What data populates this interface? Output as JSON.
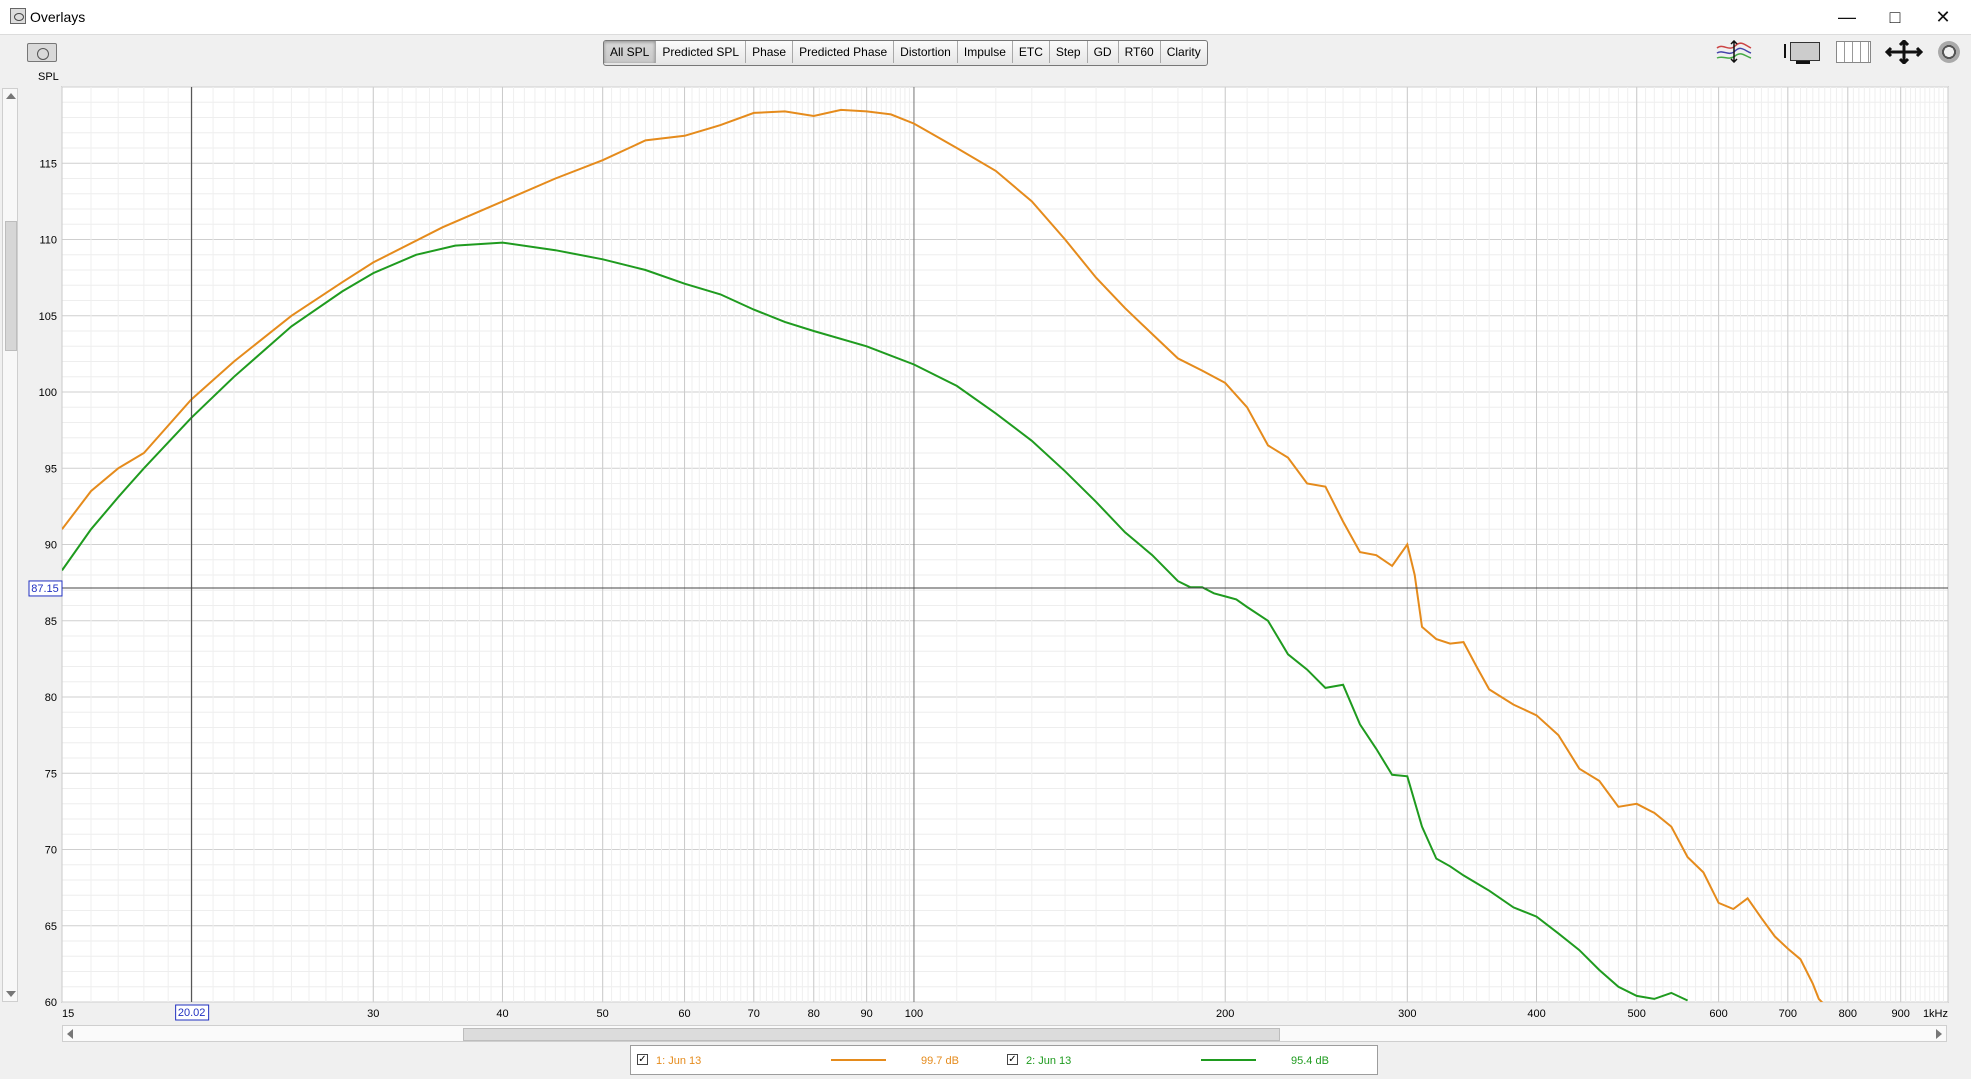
{
  "window": {
    "title": "Overlays",
    "minimize": "—",
    "maximize": "□",
    "close": "✕"
  },
  "toolbar": {
    "camera_icon": "camera-icon",
    "tabs": [
      {
        "label": "All SPL",
        "active": true
      },
      {
        "label": "Predicted SPL",
        "active": false
      },
      {
        "label": "Phase",
        "active": false
      },
      {
        "label": "Predicted Phase",
        "active": false
      },
      {
        "label": "Distortion",
        "active": false
      },
      {
        "label": "Impulse",
        "active": false
      },
      {
        "label": "ETC",
        "active": false
      },
      {
        "label": "Step",
        "active": false
      },
      {
        "label": "GD",
        "active": false
      },
      {
        "label": "RT60",
        "active": false
      },
      {
        "label": "Clarity",
        "active": false
      }
    ],
    "right_icons": [
      "graph-scale-icon",
      "measurement-icon",
      "columns-icon",
      "fit-arrows-icon",
      "gear-icon"
    ]
  },
  "chart_data": {
    "type": "line",
    "title": "",
    "ylabel": "SPL",
    "xlabel": "",
    "x_scale": "log",
    "xlim": [
      15,
      1000
    ],
    "ylim": [
      60,
      120
    ],
    "grid": true,
    "x_tick_labels": [
      {
        "value": 15,
        "label": "15"
      },
      {
        "value": 30,
        "label": "30"
      },
      {
        "value": 40,
        "label": "40"
      },
      {
        "value": 50,
        "label": "50"
      },
      {
        "value": 60,
        "label": "60"
      },
      {
        "value": 70,
        "label": "70"
      },
      {
        "value": 80,
        "label": "80"
      },
      {
        "value": 90,
        "label": "90"
      },
      {
        "value": 100,
        "label": "100"
      },
      {
        "value": 200,
        "label": "200"
      },
      {
        "value": 300,
        "label": "300"
      },
      {
        "value": 400,
        "label": "400"
      },
      {
        "value": 500,
        "label": "500"
      },
      {
        "value": 600,
        "label": "600"
      },
      {
        "value": 700,
        "label": "700"
      },
      {
        "value": 800,
        "label": "800"
      },
      {
        "value": 900,
        "label": "900"
      },
      {
        "value": 1000,
        "label": "1kHz"
      }
    ],
    "y_ticks": [
      60,
      65,
      70,
      75,
      80,
      85,
      90,
      95,
      100,
      105,
      110,
      115
    ],
    "cursor": {
      "x": 20.02,
      "y": 87.15,
      "x_label": "20.02",
      "y_label": "87.15"
    },
    "series": [
      {
        "name": "1: Jun 13",
        "color": "#e58b1c",
        "x": [
          15,
          16,
          17,
          18,
          20,
          22,
          25,
          28,
          30,
          35,
          40,
          45,
          50,
          55,
          60,
          65,
          70,
          75,
          80,
          85,
          90,
          95,
          100,
          110,
          120,
          130,
          140,
          150,
          160,
          170,
          180,
          190,
          200,
          210,
          220,
          230,
          240,
          250,
          260,
          270,
          280,
          290,
          300,
          305,
          310,
          320,
          330,
          340,
          350,
          360,
          380,
          400,
          420,
          440,
          460,
          480,
          500,
          520,
          540,
          560,
          580,
          600,
          620,
          640,
          660,
          680,
          700,
          720,
          740,
          750,
          760
        ],
        "y": [
          91,
          93.5,
          95,
          96,
          99.5,
          102,
          105,
          107.2,
          108.5,
          110.8,
          112.5,
          114,
          115.2,
          116.5,
          116.8,
          117.5,
          118.3,
          118.4,
          118.1,
          118.5,
          118.4,
          118.2,
          117.6,
          116,
          114.5,
          112.5,
          110,
          107.5,
          105.5,
          103.8,
          102.2,
          101.4,
          100.6,
          99,
          96.5,
          95.7,
          94,
          93.8,
          91.5,
          89.5,
          89.3,
          88.6,
          90,
          88,
          84.6,
          83.8,
          83.5,
          83.6,
          82,
          80.5,
          79.5,
          78.8,
          77.5,
          75.3,
          74.5,
          72.8,
          73,
          72.4,
          71.5,
          69.5,
          68.5,
          66.5,
          66.1,
          66.8,
          65.5,
          64.3,
          63.5,
          62.8,
          61.2,
          60.2,
          59.8
        ]
      },
      {
        "name": "2: Jun 13",
        "color": "#1f9b1f",
        "x": [
          15,
          16,
          17,
          18,
          20,
          22,
          25,
          28,
          30,
          33,
          36,
          40,
          45,
          50,
          55,
          60,
          65,
          70,
          75,
          80,
          90,
          100,
          110,
          120,
          130,
          140,
          150,
          160,
          170,
          180,
          185,
          190,
          195,
          200,
          205,
          210,
          220,
          230,
          240,
          250,
          260,
          270,
          280,
          290,
          300,
          310,
          320,
          330,
          340,
          360,
          380,
          400,
          420,
          440,
          460,
          480,
          500,
          520,
          540,
          560
        ],
        "y": [
          88.3,
          91,
          93.1,
          95,
          98.3,
          101,
          104.3,
          106.6,
          107.8,
          109,
          109.6,
          109.8,
          109.3,
          108.7,
          108,
          107.1,
          106.4,
          105.4,
          104.6,
          104,
          103,
          101.8,
          100.4,
          98.6,
          96.8,
          94.8,
          92.8,
          90.8,
          89.3,
          87.6,
          87.2,
          87.2,
          86.8,
          86.6,
          86.4,
          85.9,
          85,
          82.8,
          81.8,
          80.6,
          80.8,
          78.2,
          76.6,
          74.9,
          74.8,
          71.5,
          69.4,
          68.9,
          68.3,
          67.3,
          66.2,
          65.6,
          64.5,
          63.4,
          62.1,
          61,
          60.4,
          60.2,
          60.6,
          60.1
        ]
      }
    ]
  },
  "legend": {
    "items": [
      {
        "checked": true,
        "name": "1: Jun 13",
        "value": "99.7 dB",
        "color": "#e58b1c",
        "check": "✓"
      },
      {
        "checked": true,
        "name": "2: Jun 13",
        "value": "95.4 dB",
        "color": "#1f9b1f",
        "check": "✓"
      }
    ]
  }
}
